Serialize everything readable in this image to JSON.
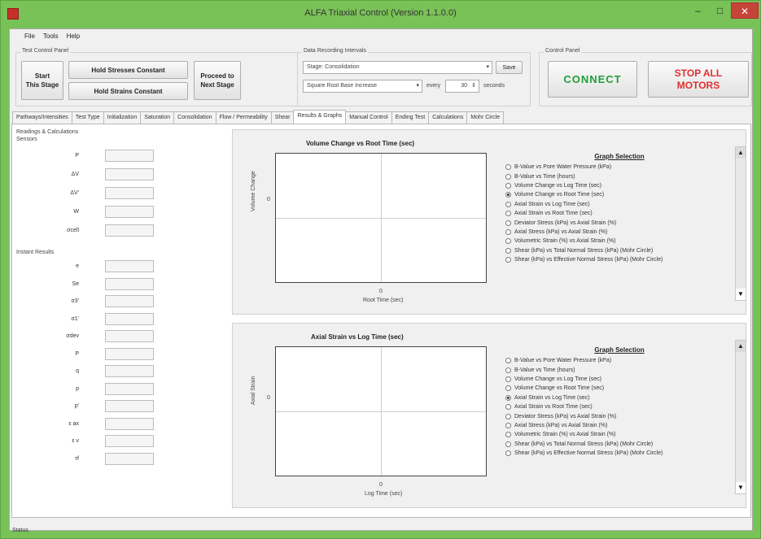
{
  "window": {
    "title": "ALFA Triaxial Control (Version 1.1.0.0)",
    "min": "–",
    "max": "□",
    "close": "✕"
  },
  "menu": [
    "File",
    "Tools",
    "Help"
  ],
  "test_control": {
    "label": "Test Control Panel",
    "start_line1": "Start",
    "start_line2": "This Stage",
    "hold_stresses": "Hold Stresses Constant",
    "hold_strains": "Hold Strains Constant",
    "proceed_line1": "Proceed to",
    "proceed_line2": "Next Stage"
  },
  "data_recording": {
    "label": "Data Recording Intervals",
    "stage_value": "Stage: Consolidation",
    "save": "Save",
    "interval_type": "Square Root Base Increase",
    "every": "every",
    "every_value": "30",
    "unit": "seconds"
  },
  "control_panel": {
    "label": "Control Panel",
    "connect": "CONNECT",
    "stop_line1": "STOP ALL",
    "stop_line2": "MOTORS"
  },
  "tabs": [
    "Pathways/Intensities",
    "Test Type",
    "Initialization",
    "Saturation",
    "Consolidation",
    "Flow / Permeability",
    "Shear",
    "Results & Graphs",
    "Manual Control",
    "Ending Test",
    "Calculations",
    "Mohr Circle"
  ],
  "active_tab": "Results & Graphs",
  "readings": {
    "title": "Readings & Calculations",
    "sensors_label": "Sensors",
    "sensors": [
      "P",
      "ΔV",
      "ΔV'",
      "W",
      "σcell"
    ],
    "instant_label": "Instant Results",
    "instant": [
      "e",
      "Se",
      "σ3'",
      "σ1'",
      "σdev",
      "P",
      "q",
      "p",
      "p'",
      "ε ax",
      "ε v",
      "τf"
    ]
  },
  "graph1": {
    "title": "Volume Change vs Root Time (sec)",
    "ylabel": "Volume Change",
    "xlabel": "Root Time (sec)",
    "y_zero": "0",
    "x_zero": "0"
  },
  "graph2": {
    "title": "Axial Strain vs Log Time (sec)",
    "ylabel": "Axial Strain",
    "xlabel": "Log Time (sec)",
    "y_zero": "0",
    "x_zero": "0"
  },
  "selection1": {
    "heading": "Graph Selection",
    "options": [
      "B-Value vs Pore Water Pressure (kPa)",
      "B-Value vs Time (hours)",
      "Volume Change vs Log Time (sec)",
      "Volume Change vs Root Time (sec)",
      "Axial Strain vs Log Time (sec)",
      "Axial Strain vs Root Time (sec)",
      "Deviator Stress (kPa) vs Axial Strain (%)",
      "Axial Stress (kPa) vs Axial Strain (%)",
      "Volumetric Strain (%) vs Axial Strain (%)",
      "Shear (kPa) vs Total Normal Stress (kPa) (Mohr Circle)",
      "Shear (kPa) vs Effective Normal Stress (kPa) (Mohr Circle)"
    ],
    "selected": 3
  },
  "selection2": {
    "heading": "Graph Selection",
    "options": [
      "B-Value vs Pore Water Pressure (kPa)",
      "B-Value vs Time (hours)",
      "Volume Change vs Log Time (sec)",
      "Volume Change vs Root Time (sec)",
      "Axial Strain vs Log Time (sec)",
      "Axial Strain vs Root Time (sec)",
      "Deviator Stress (kPa) vs Axial Strain (%)",
      "Axial Stress (kPa) vs Axial Strain (%)",
      "Volumetric Strain (%) vs Axial Strain (%)",
      "Shear (kPa) vs Total Normal Stress (kPa) (Mohr Circle)",
      "Shear (kPa) vs Effective Normal Stress (kPa) (Mohr Circle)"
    ],
    "selected": 4
  },
  "status": "Status"
}
